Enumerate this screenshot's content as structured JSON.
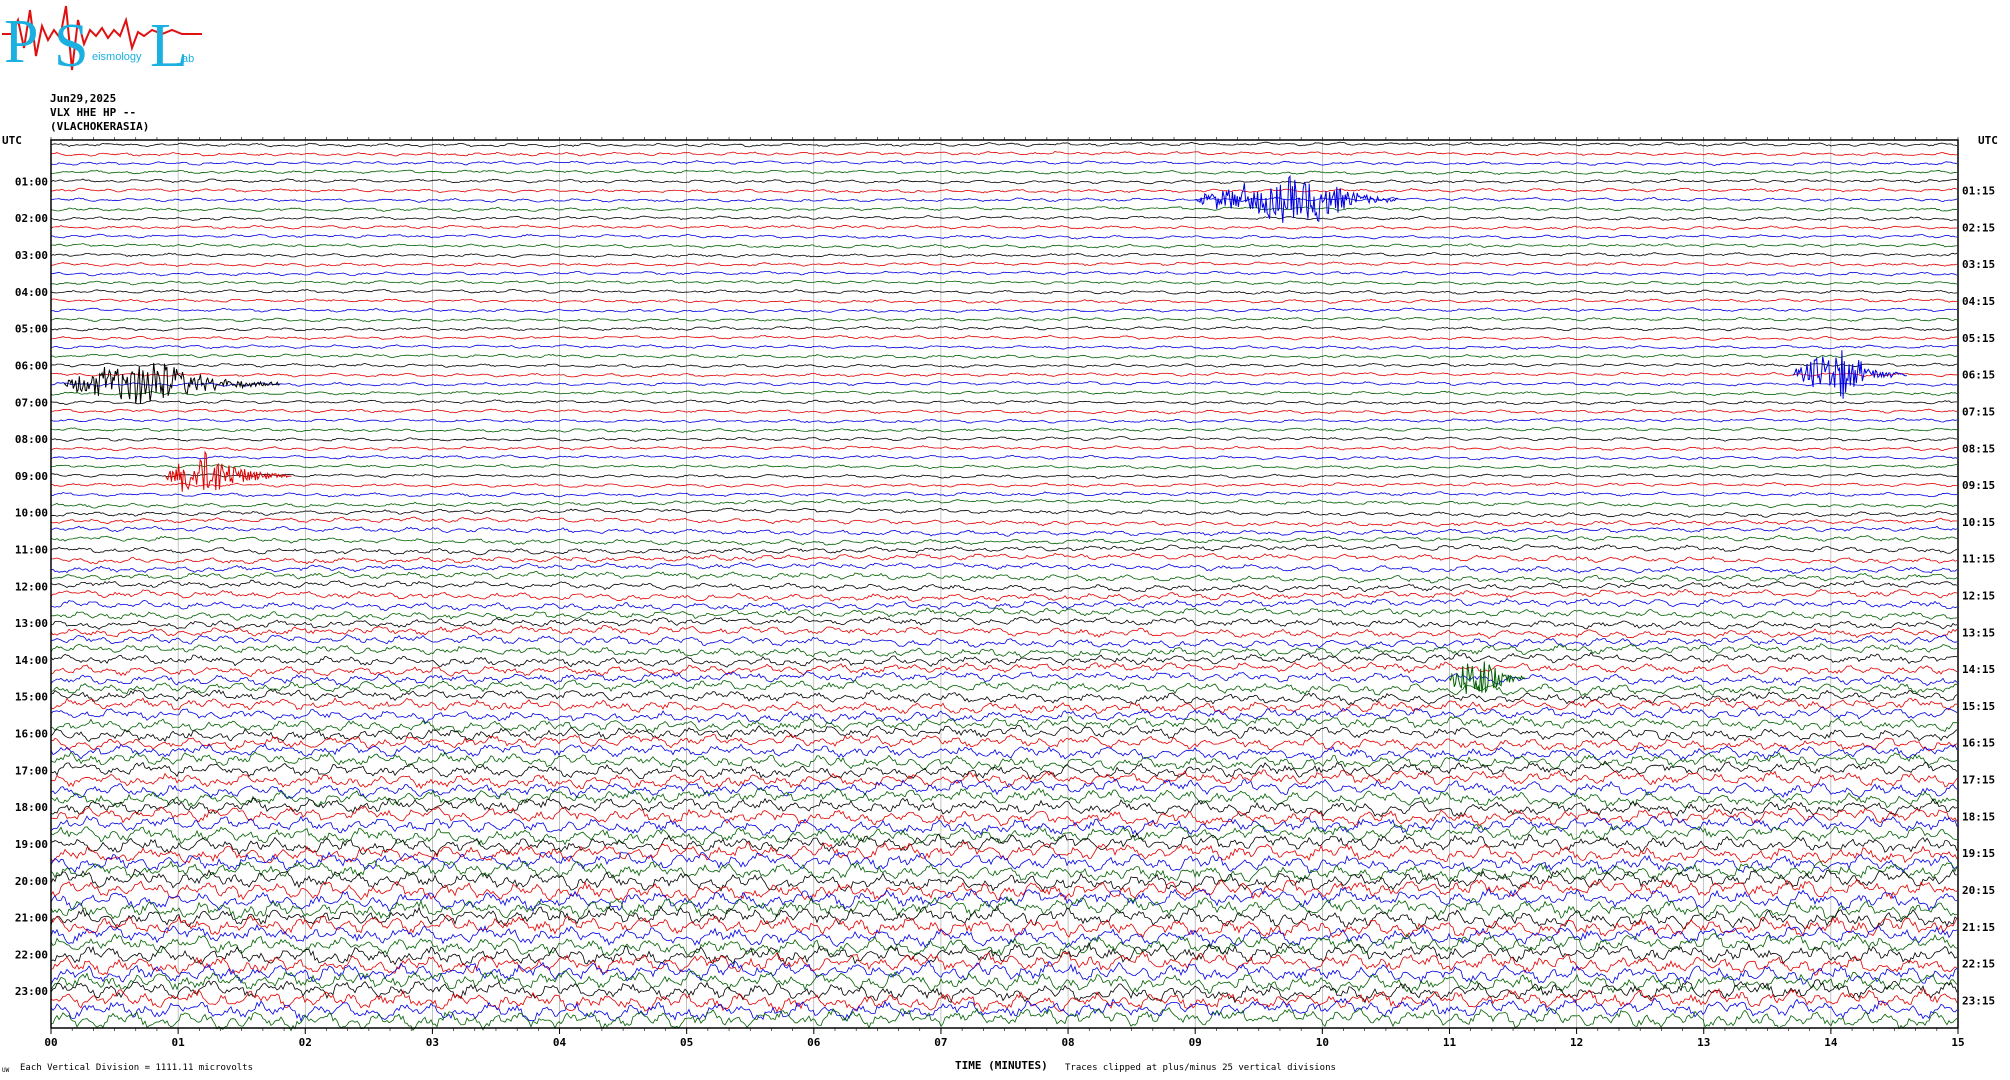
{
  "header": {
    "date": "Jun29,2025",
    "station": "VLX HHE HP --",
    "location": "(VLACHOKERASIA)"
  },
  "logo": {
    "text": "PSL",
    "subtext_s": "eismology",
    "subtext_l": "ab",
    "colors": {
      "letters": "#1ab0e0",
      "trace": "#e01010"
    }
  },
  "footer": {
    "division_note": "Each Vertical Division = 1111.11 microvolts",
    "time_label": "TIME (MINUTES)",
    "clip_note": "Traces clipped at plus/minus 25 vertical divisions",
    "corner_mark": "UW"
  },
  "chart_data": {
    "type": "line",
    "title": "",
    "xlabel": "TIME (MINUTES)",
    "ylabel": "UTC",
    "right_ylabel": "UTC",
    "xlim": [
      0,
      15
    ],
    "x_ticks": [
      "00",
      "01",
      "02",
      "03",
      "04",
      "05",
      "06",
      "07",
      "08",
      "09",
      "10",
      "11",
      "12",
      "13",
      "14",
      "15"
    ],
    "left_hour_labels": [
      "01:00",
      "02:00",
      "03:00",
      "04:00",
      "05:00",
      "06:00",
      "07:00",
      "08:00",
      "09:00",
      "10:00",
      "11:00",
      "12:00",
      "13:00",
      "14:00",
      "15:00",
      "16:00",
      "17:00",
      "18:00",
      "19:00",
      "20:00",
      "21:00",
      "22:00",
      "23:00"
    ],
    "right_hour_labels": [
      "01:15",
      "02:15",
      "03:15",
      "04:15",
      "05:15",
      "06:15",
      "07:15",
      "08:15",
      "09:15",
      "10:15",
      "11:15",
      "12:15",
      "13:15",
      "14:15",
      "15:15",
      "16:15",
      "17:15",
      "18:15",
      "19:15",
      "20:15",
      "21:15",
      "22:15",
      "23:15"
    ],
    "trace_minutes": 15,
    "trace_count": 96,
    "trace_colors": [
      "#000000",
      "#e00000",
      "#0000e0",
      "#006000"
    ],
    "right_values": [
      "-5691",
      "-5683",
      "-5686",
      "-5692",
      "-5681",
      "-5676",
      "-5683",
      "-5686",
      "-5697",
      "-5684",
      "-5677",
      "-5685",
      "-5664",
      "-5682",
      "-5696",
      "-5779",
      "-5816",
      "-5822",
      "-5826",
      "-5866",
      "-6491",
      "-6691",
      "-6622",
      "-6437",
      "-5998",
      "-5955",
      "-5918",
      "-5856",
      "-5963",
      "-5886",
      "-5888",
      "-5767",
      "-5731",
      "-5756",
      "-5787",
      "-5522",
      "-5359",
      "-5693",
      "-5622",
      "-5663",
      "-5697",
      "-4688",
      "-5294",
      "-5683",
      "-5706",
      "-5560",
      "-5583",
      "-5458",
      "-5497",
      "-5259",
      "-5133",
      "-5467",
      "-5363",
      "-5357",
      "-5589",
      "-5684",
      "-6472",
      "-6142",
      "-5514",
      "-5311",
      "-5724",
      "-5702",
      "-5610",
      "-5647",
      "-5696",
      "-5492",
      "-5536",
      "-5483",
      "-5494",
      "-5442",
      "-5401",
      "-5332",
      "-5329",
      "-5397",
      "-5474",
      "-5527",
      "-5529",
      "-5580",
      "-5631",
      "-5626",
      "-5599",
      "-5630",
      "-5644",
      "-5661",
      "-5689",
      "-5670",
      "-5678",
      "-5676",
      "-5687",
      "-5672",
      "-5679",
      "-5792",
      "-5767",
      "-5694",
      "-5693",
      "-5687",
      "-5675"
    ],
    "events": [
      {
        "name": "event-0642",
        "trace": 26,
        "start_min": 0.1,
        "peak_min": 0.8,
        "end_min": 1.8,
        "color": "#000000"
      },
      {
        "name": "event-0638",
        "trace": 25,
        "start_min": 13.7,
        "peak_min": 14.1,
        "end_min": 14.6,
        "color": "#0000e0"
      },
      {
        "name": "event-1000",
        "trace": 36,
        "start_min": 0.9,
        "peak_min": 1.25,
        "end_min": 1.9,
        "color": "#e00000"
      },
      {
        "name": "event-1442",
        "trace": 58,
        "start_min": 11.0,
        "peak_min": 11.25,
        "end_min": 11.6,
        "color": "#006000"
      },
      {
        "name": "event-0130",
        "trace": 6,
        "start_min": 9.0,
        "peak_min": 10.0,
        "end_min": 10.6,
        "color": "#0000e0"
      }
    ],
    "grid": true
  }
}
